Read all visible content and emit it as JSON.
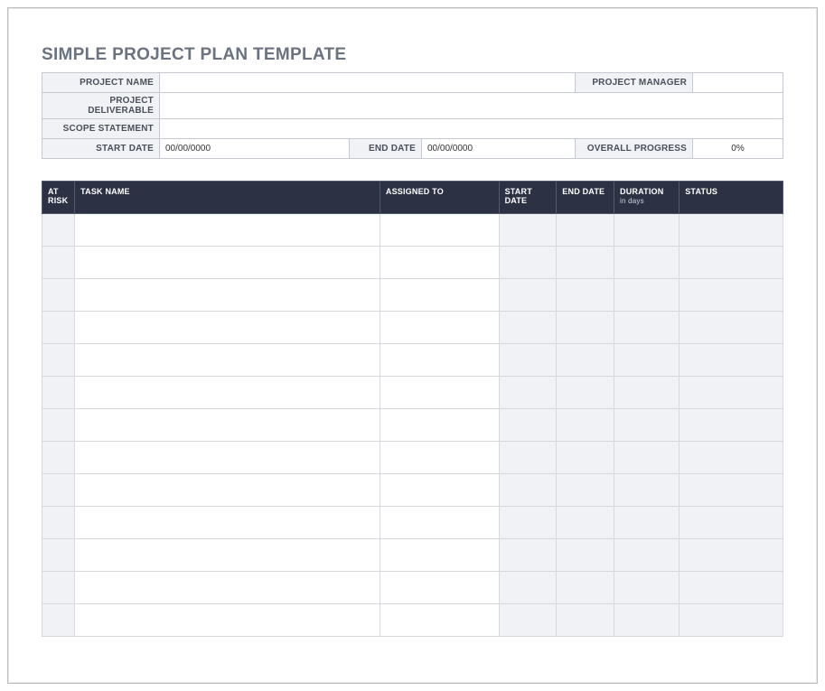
{
  "title": "SIMPLE PROJECT PLAN TEMPLATE",
  "info": {
    "project_name_label": "PROJECT NAME",
    "project_name_value": "",
    "project_manager_label": "PROJECT MANAGER",
    "project_manager_value": "",
    "deliverable_label": "PROJECT DELIVERABLE",
    "deliverable_value": "",
    "scope_label": "SCOPE STATEMENT",
    "scope_value": "",
    "start_date_label": "START DATE",
    "start_date_value": "00/00/0000",
    "end_date_label": "END DATE",
    "end_date_value": "00/00/0000",
    "progress_label": "OVERALL PROGRESS",
    "progress_value": "0%"
  },
  "table": {
    "headers": {
      "at_risk": "AT RISK",
      "task_name": "TASK NAME",
      "assigned_to": "ASSIGNED TO",
      "start_date": "START DATE",
      "end_date": "END DATE",
      "duration": "DURATION",
      "duration_sub": "in days",
      "status": "STATUS"
    },
    "rows": [
      {
        "at_risk": "",
        "task_name": "",
        "assigned_to": "",
        "start_date": "",
        "end_date": "",
        "duration": "",
        "status": ""
      },
      {
        "at_risk": "",
        "task_name": "",
        "assigned_to": "",
        "start_date": "",
        "end_date": "",
        "duration": "",
        "status": ""
      },
      {
        "at_risk": "",
        "task_name": "",
        "assigned_to": "",
        "start_date": "",
        "end_date": "",
        "duration": "",
        "status": ""
      },
      {
        "at_risk": "",
        "task_name": "",
        "assigned_to": "",
        "start_date": "",
        "end_date": "",
        "duration": "",
        "status": ""
      },
      {
        "at_risk": "",
        "task_name": "",
        "assigned_to": "",
        "start_date": "",
        "end_date": "",
        "duration": "",
        "status": ""
      },
      {
        "at_risk": "",
        "task_name": "",
        "assigned_to": "",
        "start_date": "",
        "end_date": "",
        "duration": "",
        "status": ""
      },
      {
        "at_risk": "",
        "task_name": "",
        "assigned_to": "",
        "start_date": "",
        "end_date": "",
        "duration": "",
        "status": ""
      },
      {
        "at_risk": "",
        "task_name": "",
        "assigned_to": "",
        "start_date": "",
        "end_date": "",
        "duration": "",
        "status": ""
      },
      {
        "at_risk": "",
        "task_name": "",
        "assigned_to": "",
        "start_date": "",
        "end_date": "",
        "duration": "",
        "status": ""
      },
      {
        "at_risk": "",
        "task_name": "",
        "assigned_to": "",
        "start_date": "",
        "end_date": "",
        "duration": "",
        "status": ""
      },
      {
        "at_risk": "",
        "task_name": "",
        "assigned_to": "",
        "start_date": "",
        "end_date": "",
        "duration": "",
        "status": ""
      },
      {
        "at_risk": "",
        "task_name": "",
        "assigned_to": "",
        "start_date": "",
        "end_date": "",
        "duration": "",
        "status": ""
      },
      {
        "at_risk": "",
        "task_name": "",
        "assigned_to": "",
        "start_date": "",
        "end_date": "",
        "duration": "",
        "status": ""
      }
    ]
  }
}
